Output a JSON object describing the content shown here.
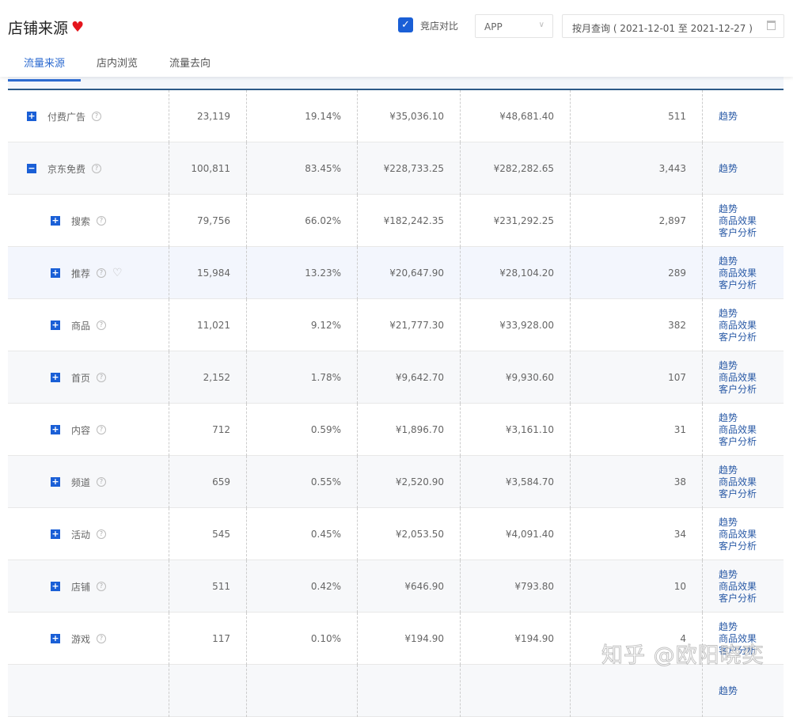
{
  "header": {
    "title": "店铺来源",
    "compare_label": "竞店对比",
    "compare_checked": true,
    "platform": "APP",
    "date_range": "按月查询 ( 2021-12-01 至 2021-12-27 )"
  },
  "tabs": [
    {
      "label": "流量来源",
      "active": true
    },
    {
      "label": "店内浏览"
    },
    {
      "label": "流量去向"
    }
  ],
  "rows": [
    {
      "name": "付费广告",
      "level": 0,
      "expand": "+",
      "v": [
        "23,119",
        "19.14%",
        "¥35,036.10",
        "¥48,681.40",
        "511"
      ],
      "actions": [
        "趋势"
      ]
    },
    {
      "name": "京东免费",
      "level": 0,
      "expand": "−",
      "v": [
        "100,811",
        "83.45%",
        "¥228,733.25",
        "¥282,282.65",
        "3,443"
      ],
      "actions": [
        "趋势"
      ]
    },
    {
      "name": "搜索",
      "level": 1,
      "expand": "+",
      "v": [
        "79,756",
        "66.02%",
        "¥182,242.35",
        "¥231,292.25",
        "2,897"
      ],
      "actions": [
        "趋势",
        "商品效果",
        "客户分析"
      ]
    },
    {
      "name": "推荐",
      "level": 1,
      "expand": "+",
      "heart": true,
      "hover": true,
      "v": [
        "15,984",
        "13.23%",
        "¥20,647.90",
        "¥28,104.20",
        "289"
      ],
      "actions": [
        "趋势",
        "商品效果",
        "客户分析"
      ]
    },
    {
      "name": "商品",
      "level": 1,
      "expand": "+",
      "v": [
        "11,021",
        "9.12%",
        "¥21,777.30",
        "¥33,928.00",
        "382"
      ],
      "actions": [
        "趋势",
        "商品效果",
        "客户分析"
      ]
    },
    {
      "name": "首页",
      "level": 1,
      "expand": "+",
      "v": [
        "2,152",
        "1.78%",
        "¥9,642.70",
        "¥9,930.60",
        "107"
      ],
      "actions": [
        "趋势",
        "商品效果",
        "客户分析"
      ]
    },
    {
      "name": "内容",
      "level": 1,
      "expand": "+",
      "v": [
        "712",
        "0.59%",
        "¥1,896.70",
        "¥3,161.10",
        "31"
      ],
      "actions": [
        "趋势",
        "商品效果",
        "客户分析"
      ]
    },
    {
      "name": "频道",
      "level": 1,
      "expand": "+",
      "v": [
        "659",
        "0.55%",
        "¥2,520.90",
        "¥3,584.70",
        "38"
      ],
      "actions": [
        "趋势",
        "商品效果",
        "客户分析"
      ]
    },
    {
      "name": "活动",
      "level": 1,
      "expand": "+",
      "v": [
        "545",
        "0.45%",
        "¥2,053.50",
        "¥4,091.40",
        "34"
      ],
      "actions": [
        "趋势",
        "商品效果",
        "客户分析"
      ]
    },
    {
      "name": "店铺",
      "level": 1,
      "expand": "+",
      "v": [
        "511",
        "0.42%",
        "¥646.90",
        "¥793.80",
        "10"
      ],
      "actions": [
        "趋势",
        "商品效果",
        "客户分析"
      ]
    },
    {
      "name": "游戏",
      "level": 1,
      "expand": "+",
      "v": [
        "117",
        "0.10%",
        "¥194.90",
        "¥194.90",
        "4"
      ],
      "actions": [
        "趋势",
        "商品效果",
        "客户分析"
      ]
    },
    {
      "name": "",
      "level": 1,
      "v": [
        "",
        "",
        "",
        "",
        ""
      ],
      "actions": [
        "趋势"
      ]
    }
  ],
  "watermark": "知乎 @欧阳晓奕"
}
